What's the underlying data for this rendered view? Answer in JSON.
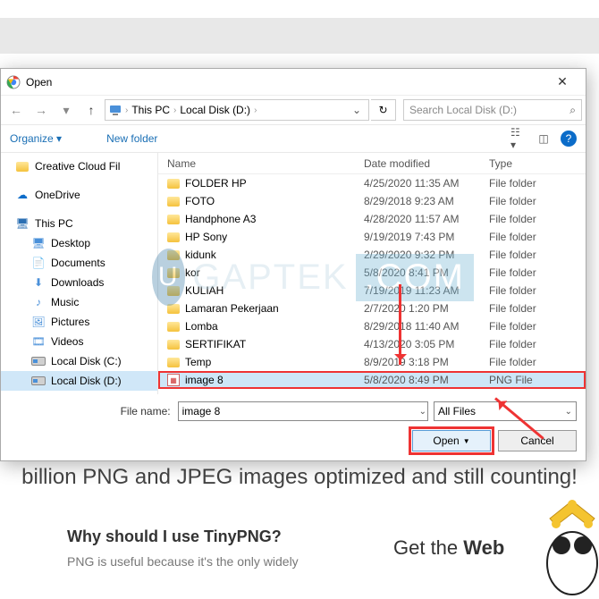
{
  "dialog": {
    "title": "Open",
    "path": {
      "root": "This PC",
      "drive": "Local Disk (D:)"
    },
    "search_placeholder": "Search Local Disk (D:)",
    "organize": "Organize",
    "new_folder": "New folder",
    "columns": {
      "name": "Name",
      "date": "Date modified",
      "type": "Type"
    },
    "filename_label": "File name:",
    "filename_value": "image 8",
    "filter": "All Files",
    "open_btn": "Open",
    "cancel_btn": "Cancel"
  },
  "sidebar": [
    {
      "label": "Creative Cloud Fil",
      "icon": "folder"
    },
    {
      "label": "OneDrive",
      "icon": "cloud"
    },
    {
      "label": "This PC",
      "icon": "pc"
    },
    {
      "label": "Desktop",
      "icon": "desktop",
      "sub": true
    },
    {
      "label": "Documents",
      "icon": "docs",
      "sub": true
    },
    {
      "label": "Downloads",
      "icon": "downloads",
      "sub": true
    },
    {
      "label": "Music",
      "icon": "music",
      "sub": true
    },
    {
      "label": "Pictures",
      "icon": "pictures",
      "sub": true
    },
    {
      "label": "Videos",
      "icon": "videos",
      "sub": true
    },
    {
      "label": "Local Disk (C:)",
      "icon": "disk",
      "sub": true
    },
    {
      "label": "Local Disk (D:)",
      "icon": "disk",
      "sub": true,
      "selected": true
    }
  ],
  "files": [
    {
      "name": "FOLDER HP",
      "date": "4/25/2020 11:35 AM",
      "type": "File folder"
    },
    {
      "name": "FOTO",
      "date": "8/29/2018 9:23 AM",
      "type": "File folder"
    },
    {
      "name": "Handphone A3",
      "date": "4/28/2020 11:57 AM",
      "type": "File folder"
    },
    {
      "name": "HP Sony",
      "date": "9/19/2019 7:43 PM",
      "type": "File folder"
    },
    {
      "name": "kidunk",
      "date": "2/29/2020 9:32 PM",
      "type": "File folder"
    },
    {
      "name": "kor",
      "date": "5/8/2020 8:41 PM",
      "type": "File folder"
    },
    {
      "name": "KULIAH",
      "date": "7/19/2019 11:23 AM",
      "type": "File folder"
    },
    {
      "name": "Lamaran Pekerjaan",
      "date": "2/7/2020 1:20 PM",
      "type": "File folder"
    },
    {
      "name": "Lomba",
      "date": "8/29/2018 11:40 AM",
      "type": "File folder"
    },
    {
      "name": "SERTIFIKAT",
      "date": "4/13/2020 3:05 PM",
      "type": "File folder"
    },
    {
      "name": "Temp",
      "date": "8/9/2019 3:18 PM",
      "type": "File folder"
    },
    {
      "name": "image 8",
      "date": "5/8/2020 8:49 PM",
      "type": "PNG File",
      "selected": true,
      "png": true
    }
  ],
  "page": {
    "billion": "billion PNG and JPEG images optimized and still counting!",
    "why": "Why should I use TinyPNG?",
    "useful": "PNG is useful because it's the only widely",
    "getweb_pre": "Get the ",
    "getweb_bold": "Web"
  },
  "watermark": {
    "brand": "GAPTEK",
    "suffix": ".COM",
    "letter": "U"
  }
}
